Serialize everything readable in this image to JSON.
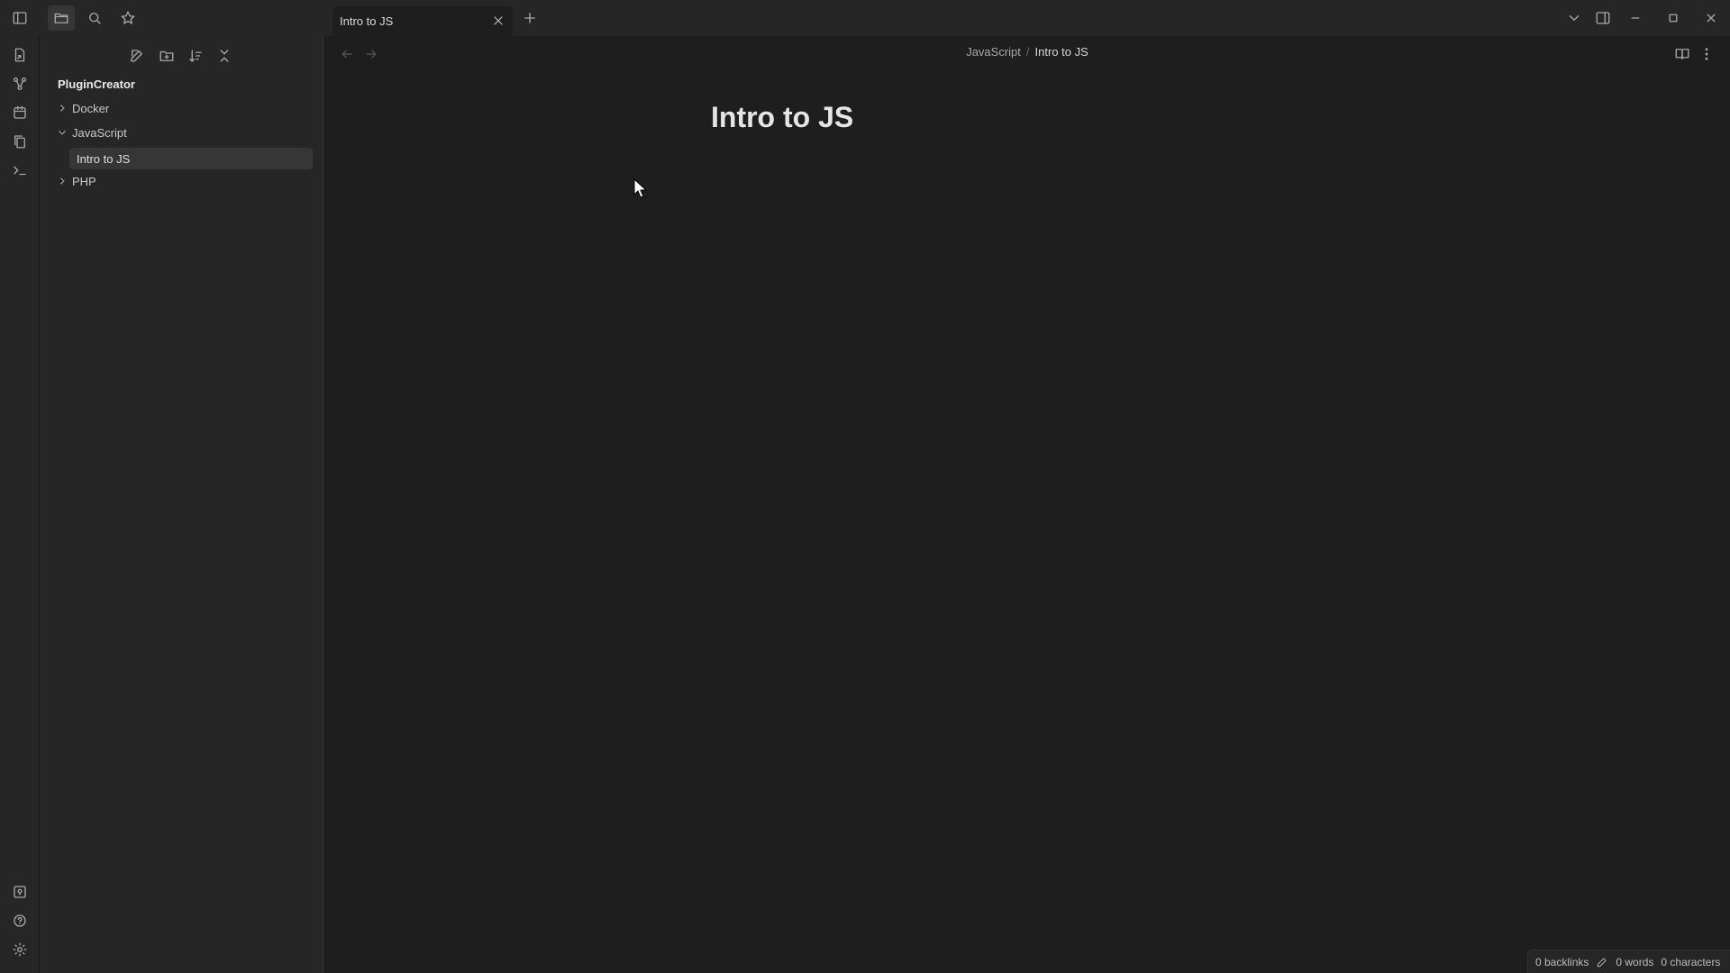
{
  "tabs": [
    {
      "label": "Intro to JS",
      "active": true
    }
  ],
  "sidebar": {
    "vault_name": "PluginCreator",
    "tree": [
      {
        "label": "Docker",
        "type": "folder",
        "expanded": false
      },
      {
        "label": "JavaScript",
        "type": "folder",
        "expanded": true
      },
      {
        "label": "Intro to JS",
        "type": "file",
        "selected": true
      },
      {
        "label": "PHP",
        "type": "folder",
        "expanded": false
      }
    ]
  },
  "editor": {
    "breadcrumb": {
      "parent": "JavaScript",
      "separator": "/",
      "current": "Intro to JS"
    },
    "title": "Intro to JS"
  },
  "status": {
    "backlinks": "0 backlinks",
    "words": "0 words",
    "characters": "0 characters"
  },
  "colors": {
    "background": "#1e1e1e",
    "panel": "#262626",
    "selected": "#363636",
    "text": "#dadada"
  }
}
